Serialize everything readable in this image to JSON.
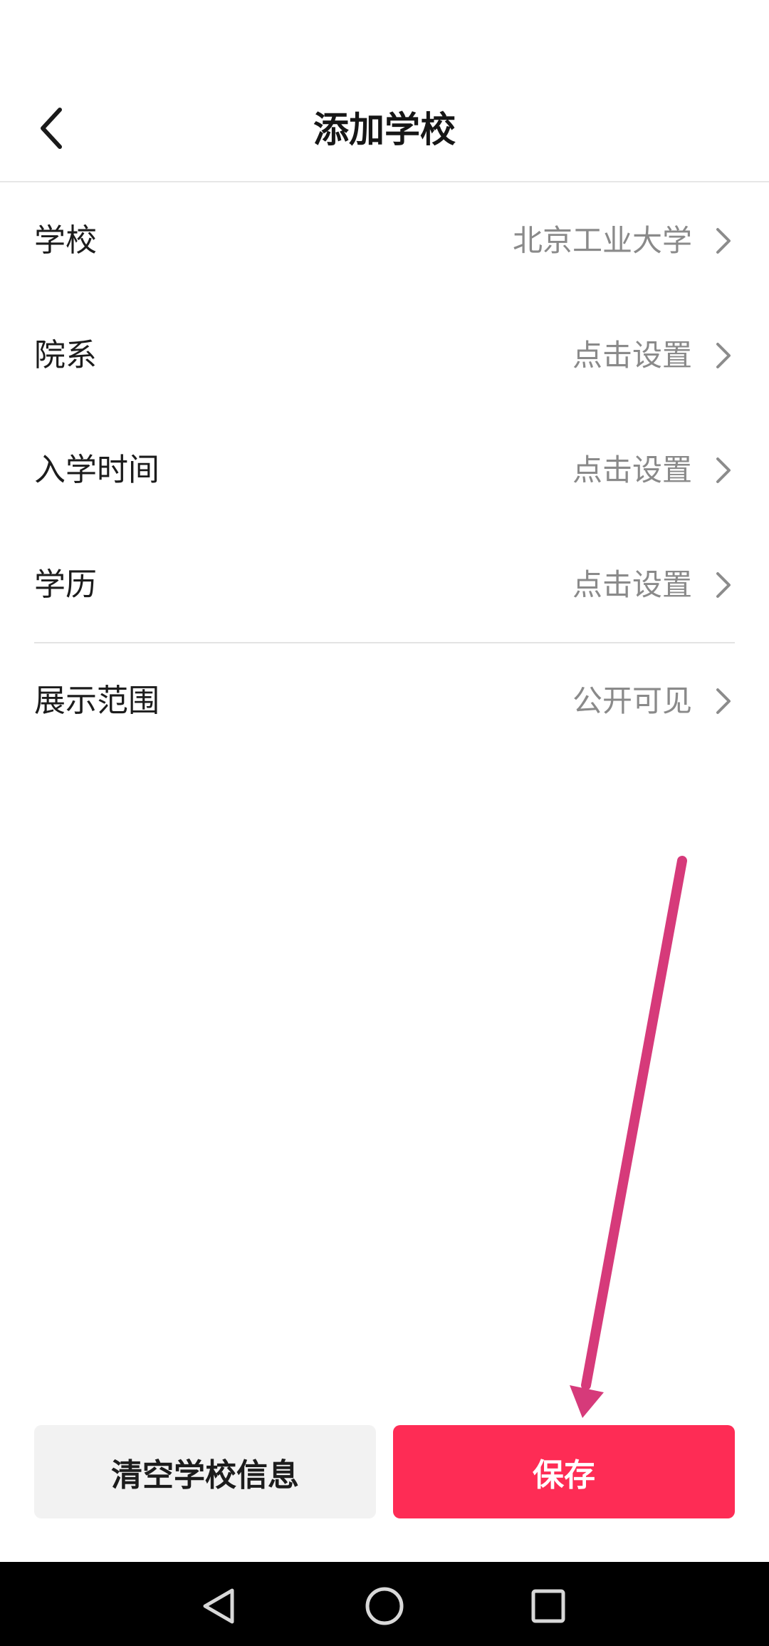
{
  "header": {
    "title": "添加学校",
    "back_icon": "chevron-left-icon"
  },
  "form": {
    "rows": [
      {
        "label": "学校",
        "value": "北京工业大学"
      },
      {
        "label": "院系",
        "value": "点击设置"
      },
      {
        "label": "入学时间",
        "value": "点击设置"
      },
      {
        "label": "学历",
        "value": "点击设置"
      },
      {
        "label": "展示范围",
        "value": "公开可见"
      }
    ]
  },
  "actions": {
    "clear_label": "清空学校信息",
    "save_label": "保存"
  },
  "colors": {
    "accent": "#fe2c55",
    "annotation_arrow": "#d63a7a"
  },
  "system_nav": {
    "back_icon": "triangle-back-icon",
    "home_icon": "circle-home-icon",
    "recents_icon": "square-recents-icon"
  }
}
